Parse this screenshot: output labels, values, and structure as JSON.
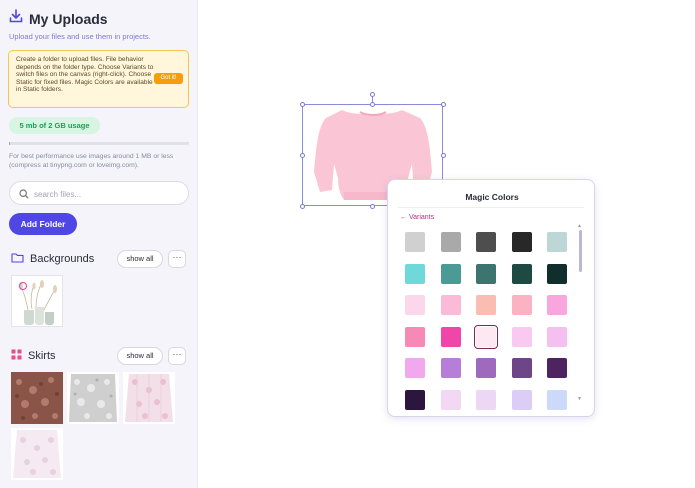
{
  "sidebar": {
    "title": "My Uploads",
    "subtitle": "Upload your files and use them in projects.",
    "note_text": "Create a folder to upload files. File behavior depends on the folder type. Choose Variants to switch files on the canvas (right-click). Choose Static for fixed files. Magic Colors are available in Static folders.",
    "got_it_label": "Got it!",
    "usage_label": "5 mb of 2 GB usage",
    "usage_fraction": 0.0025,
    "hint": "For best performance use images around 1 MB or less (compress at tinypng.com or loveimg.com).",
    "search_placeholder": "search files...",
    "add_folder_label": "Add Folder",
    "sections": [
      {
        "name": "Backgrounds",
        "show_all": "show all",
        "more": "···"
      },
      {
        "name": "Skirts",
        "show_all": "show all",
        "more": "···"
      }
    ]
  },
  "icons": {
    "upload": "download-tray-icon",
    "folder": "folder-icon",
    "grid": "grid-icon",
    "search": "search-icon"
  },
  "magic_colors": {
    "title": "Magic Colors",
    "back_label": "← Variants",
    "swatches": [
      [
        "#d0d0d0",
        "#a9a9a9",
        "#4e4e4e",
        "#282828",
        "#bdd6d6"
      ],
      [
        "#6fd8d8",
        "#4a9a95",
        "#3c7470",
        "#1f4a44",
        "#102f2c"
      ],
      [
        "#fcd7ec",
        "#fbbad8",
        "#fbbcb2",
        "#fbb3c4",
        "#f9a6df"
      ],
      [
        "#f689b6",
        "#f045a9",
        "#fde8f2",
        "#f9c9f2",
        "#f5bff0"
      ],
      [
        "#f1a8ef",
        "#b67ed8",
        "#9f69be",
        "#6e4687",
        "#4d2460"
      ],
      [
        "#2c1640",
        "#f3d8f4",
        "#ecd7f4",
        "#dccdf7",
        "#cdd9fb"
      ]
    ],
    "selected": [
      3,
      2
    ]
  },
  "colors": {
    "accent": "#4f46e5",
    "warning_bg": "#fff6dc",
    "usage_bg": "#d6f5e3",
    "usage_text": "#1f9d55"
  }
}
